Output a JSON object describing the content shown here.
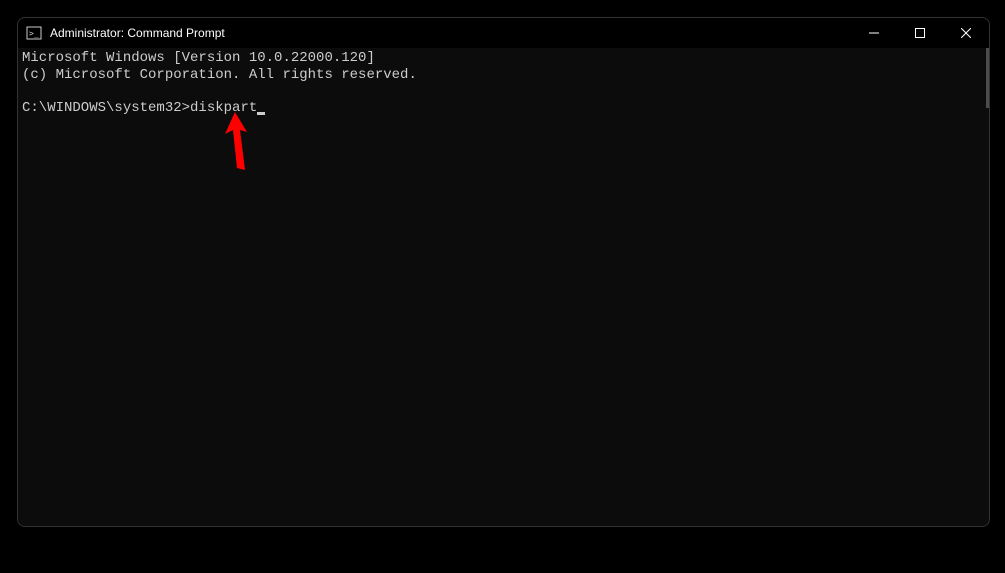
{
  "window": {
    "title": "Administrator: Command Prompt"
  },
  "terminal": {
    "line1": "Microsoft Windows [Version 10.0.22000.120]",
    "line2": "(c) Microsoft Corporation. All rights reserved.",
    "prompt": "C:\\WINDOWS\\system32>",
    "command": "diskpart"
  },
  "icons": {
    "app": "cmd-icon",
    "minimize": "minimize-icon",
    "maximize": "maximize-icon",
    "close": "close-icon"
  }
}
